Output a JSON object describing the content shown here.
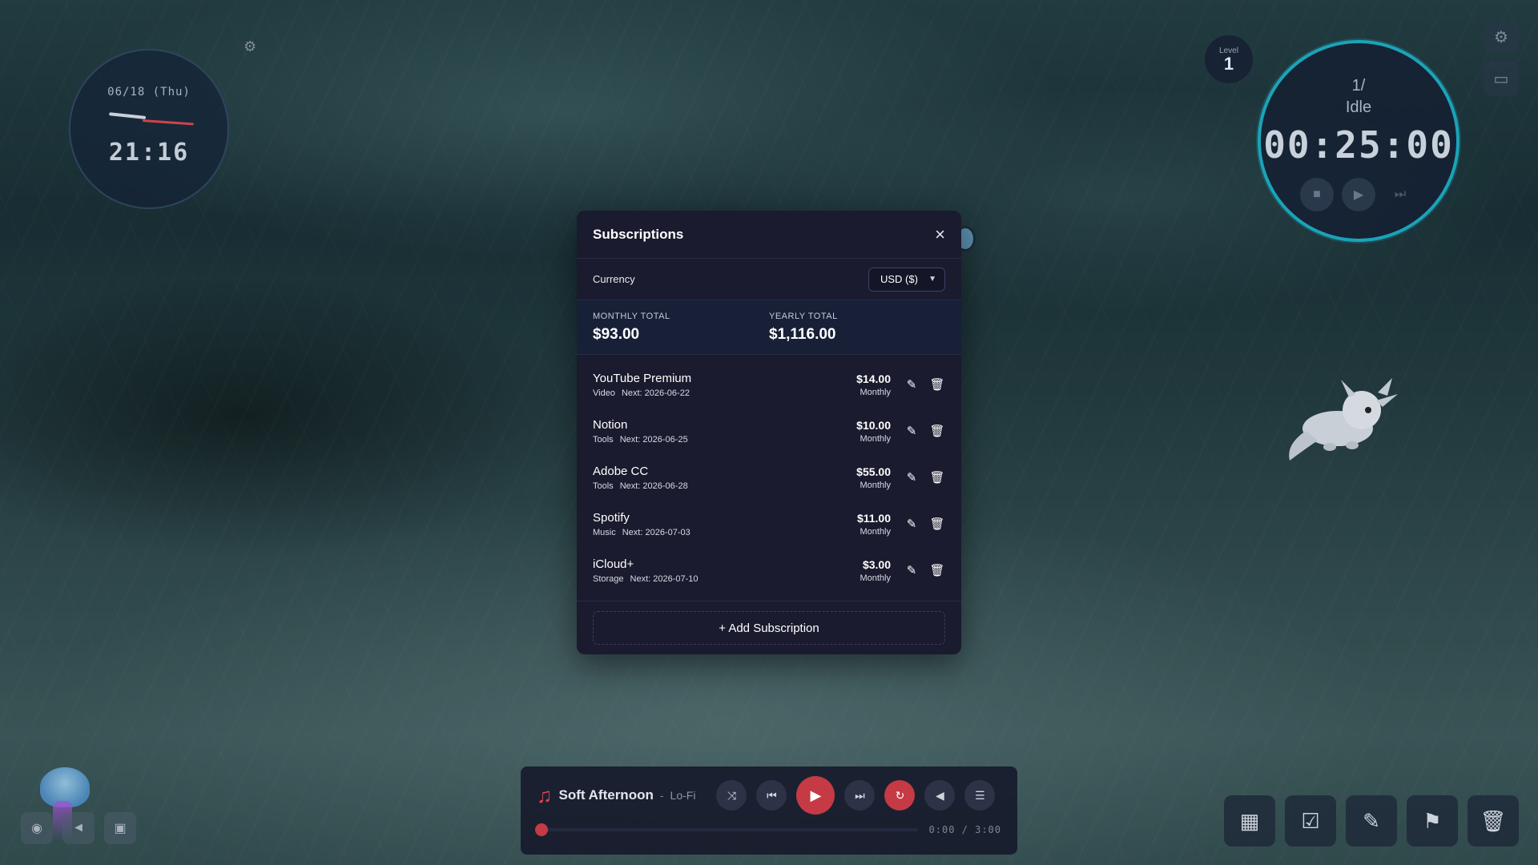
{
  "clock": {
    "date": "06/18 (Thu)",
    "time": "21:16"
  },
  "level": {
    "label": "Level",
    "value": "1"
  },
  "pomodoro": {
    "count": "1/",
    "state": "Idle",
    "timer": "00:25:00"
  },
  "modal": {
    "title": "Subscriptions",
    "currency_label": "Currency",
    "currency_value": "USD ($)",
    "monthly_total_label": "MONTHLY TOTAL",
    "monthly_total": "$93.00",
    "yearly_total_label": "YEARLY TOTAL",
    "yearly_total": "$1,116.00",
    "subscriptions": [
      {
        "name": "YouTube Premium",
        "category": "Video",
        "next": "Next: 2026-06-22",
        "price": "$14.00",
        "period": "Monthly"
      },
      {
        "name": "Notion",
        "category": "Tools",
        "next": "Next: 2026-06-25",
        "price": "$10.00",
        "period": "Monthly"
      },
      {
        "name": "Adobe CC",
        "category": "Tools",
        "next": "Next: 2026-06-28",
        "price": "$55.00",
        "period": "Monthly"
      },
      {
        "name": "Spotify",
        "category": "Music",
        "next": "Next: 2026-07-03",
        "price": "$11.00",
        "period": "Monthly"
      },
      {
        "name": "iCloud+",
        "category": "Storage",
        "next": "Next: 2026-07-10",
        "price": "$3.00",
        "period": "Monthly"
      }
    ],
    "add_label": "+ Add Subscription"
  },
  "player": {
    "title": "Soft Afternoon",
    "separator": "-",
    "genre": "Lo-Fi",
    "time": "0:00 / 3:00",
    "progress": 0
  },
  "icons": {
    "close": "close-icon",
    "edit": "pencil-icon",
    "delete": "trash-icon",
    "dock": [
      "calendar-icon",
      "checkbox-icon",
      "pencil-icon",
      "bookmark-icon",
      "trash-icon"
    ]
  },
  "colors": {
    "accent": "#c53a45",
    "timer_ring": "#1ba3b8",
    "modal_bg": "#1a1b2e"
  }
}
